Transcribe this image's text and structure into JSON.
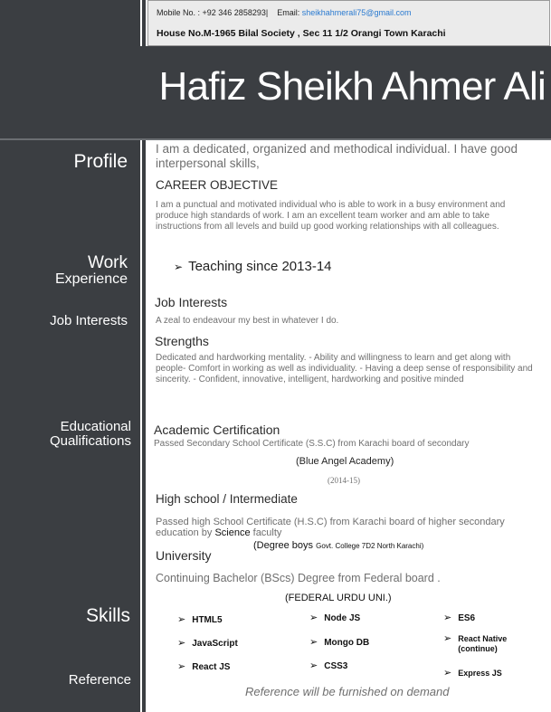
{
  "contact": {
    "mobile_label": "Mobile No. : +92 346 2858293|",
    "email_label": "Email:",
    "email": "sheikhahmerali75@gmail.com",
    "address": "House No.M-1965 Bilal Society , Sec 11 1/2 Orangi Town Karachi"
  },
  "name": "Hafiz Sheikh Ahmer Ali",
  "sidebar": {
    "profile": "Profile",
    "work_line1": "Work",
    "work_line2": "Experience",
    "job_interests": "Job Interests",
    "edu_line1": "Educational",
    "edu_line2": "Qualifications",
    "skills": "Skills",
    "reference": "Reference"
  },
  "profile": {
    "intro": "I am a dedicated, organized and methodical individual. I have good interpersonal skills,",
    "objective_title": "CAREER OBJECTIVE",
    "objective_text": "I am a punctual and motivated individual who is able to work in a busy environment and produce high standards of work. I am an excellent team worker and am able to take instructions from all levels and build up good working relationships with all colleagues."
  },
  "work": {
    "item": "Teaching  since 2013-14"
  },
  "job_interests": {
    "title": "Job Interests",
    "text": "A zeal to endeavour my best in whatever I do."
  },
  "strengths": {
    "title": "Strengths",
    "text": "Dedicated and hardworking mentality. - Ability and willingness to learn and get along with people- Comfort in working as well as individuality. - Having a deep sense of responsibility and sincerity. - Confident, innovative, intelligent, hardworking and positive minded"
  },
  "education": {
    "academic_title": "Academic Certification",
    "academic_text": "Passed Secondary School Certificate (S.S.C) from Karachi board of secondary",
    "academic_school": "(Blue Angel Academy)",
    "academic_years": "(2014-15)",
    "hs_title": "High school / Intermediate",
    "hs_text_1": "Passed high School Certificate (H.S.C) from Karachi board of higher secondary education by ",
    "hs_text_bold": "Science",
    "hs_text_2": " faculty",
    "hs_degree": "(Degree boys",
    "hs_college": "Govt. College 7D2 North Karachi)",
    "uni_title": "University",
    "uni_text": "Continuing Bachelor (BScs) Degree from Federal board .",
    "uni_name": "(FEDERAL URDU UNI.)"
  },
  "skills": {
    "col1": [
      "HTML5",
      "JavaScript",
      "React JS"
    ],
    "col2": [
      "Node JS",
      "Mongo DB",
      "CSS3"
    ],
    "col3": [
      "ES6",
      "React Native",
      "(continue)",
      "Express JS"
    ]
  },
  "reference": {
    "text": "Reference will be furnished on demand"
  }
}
